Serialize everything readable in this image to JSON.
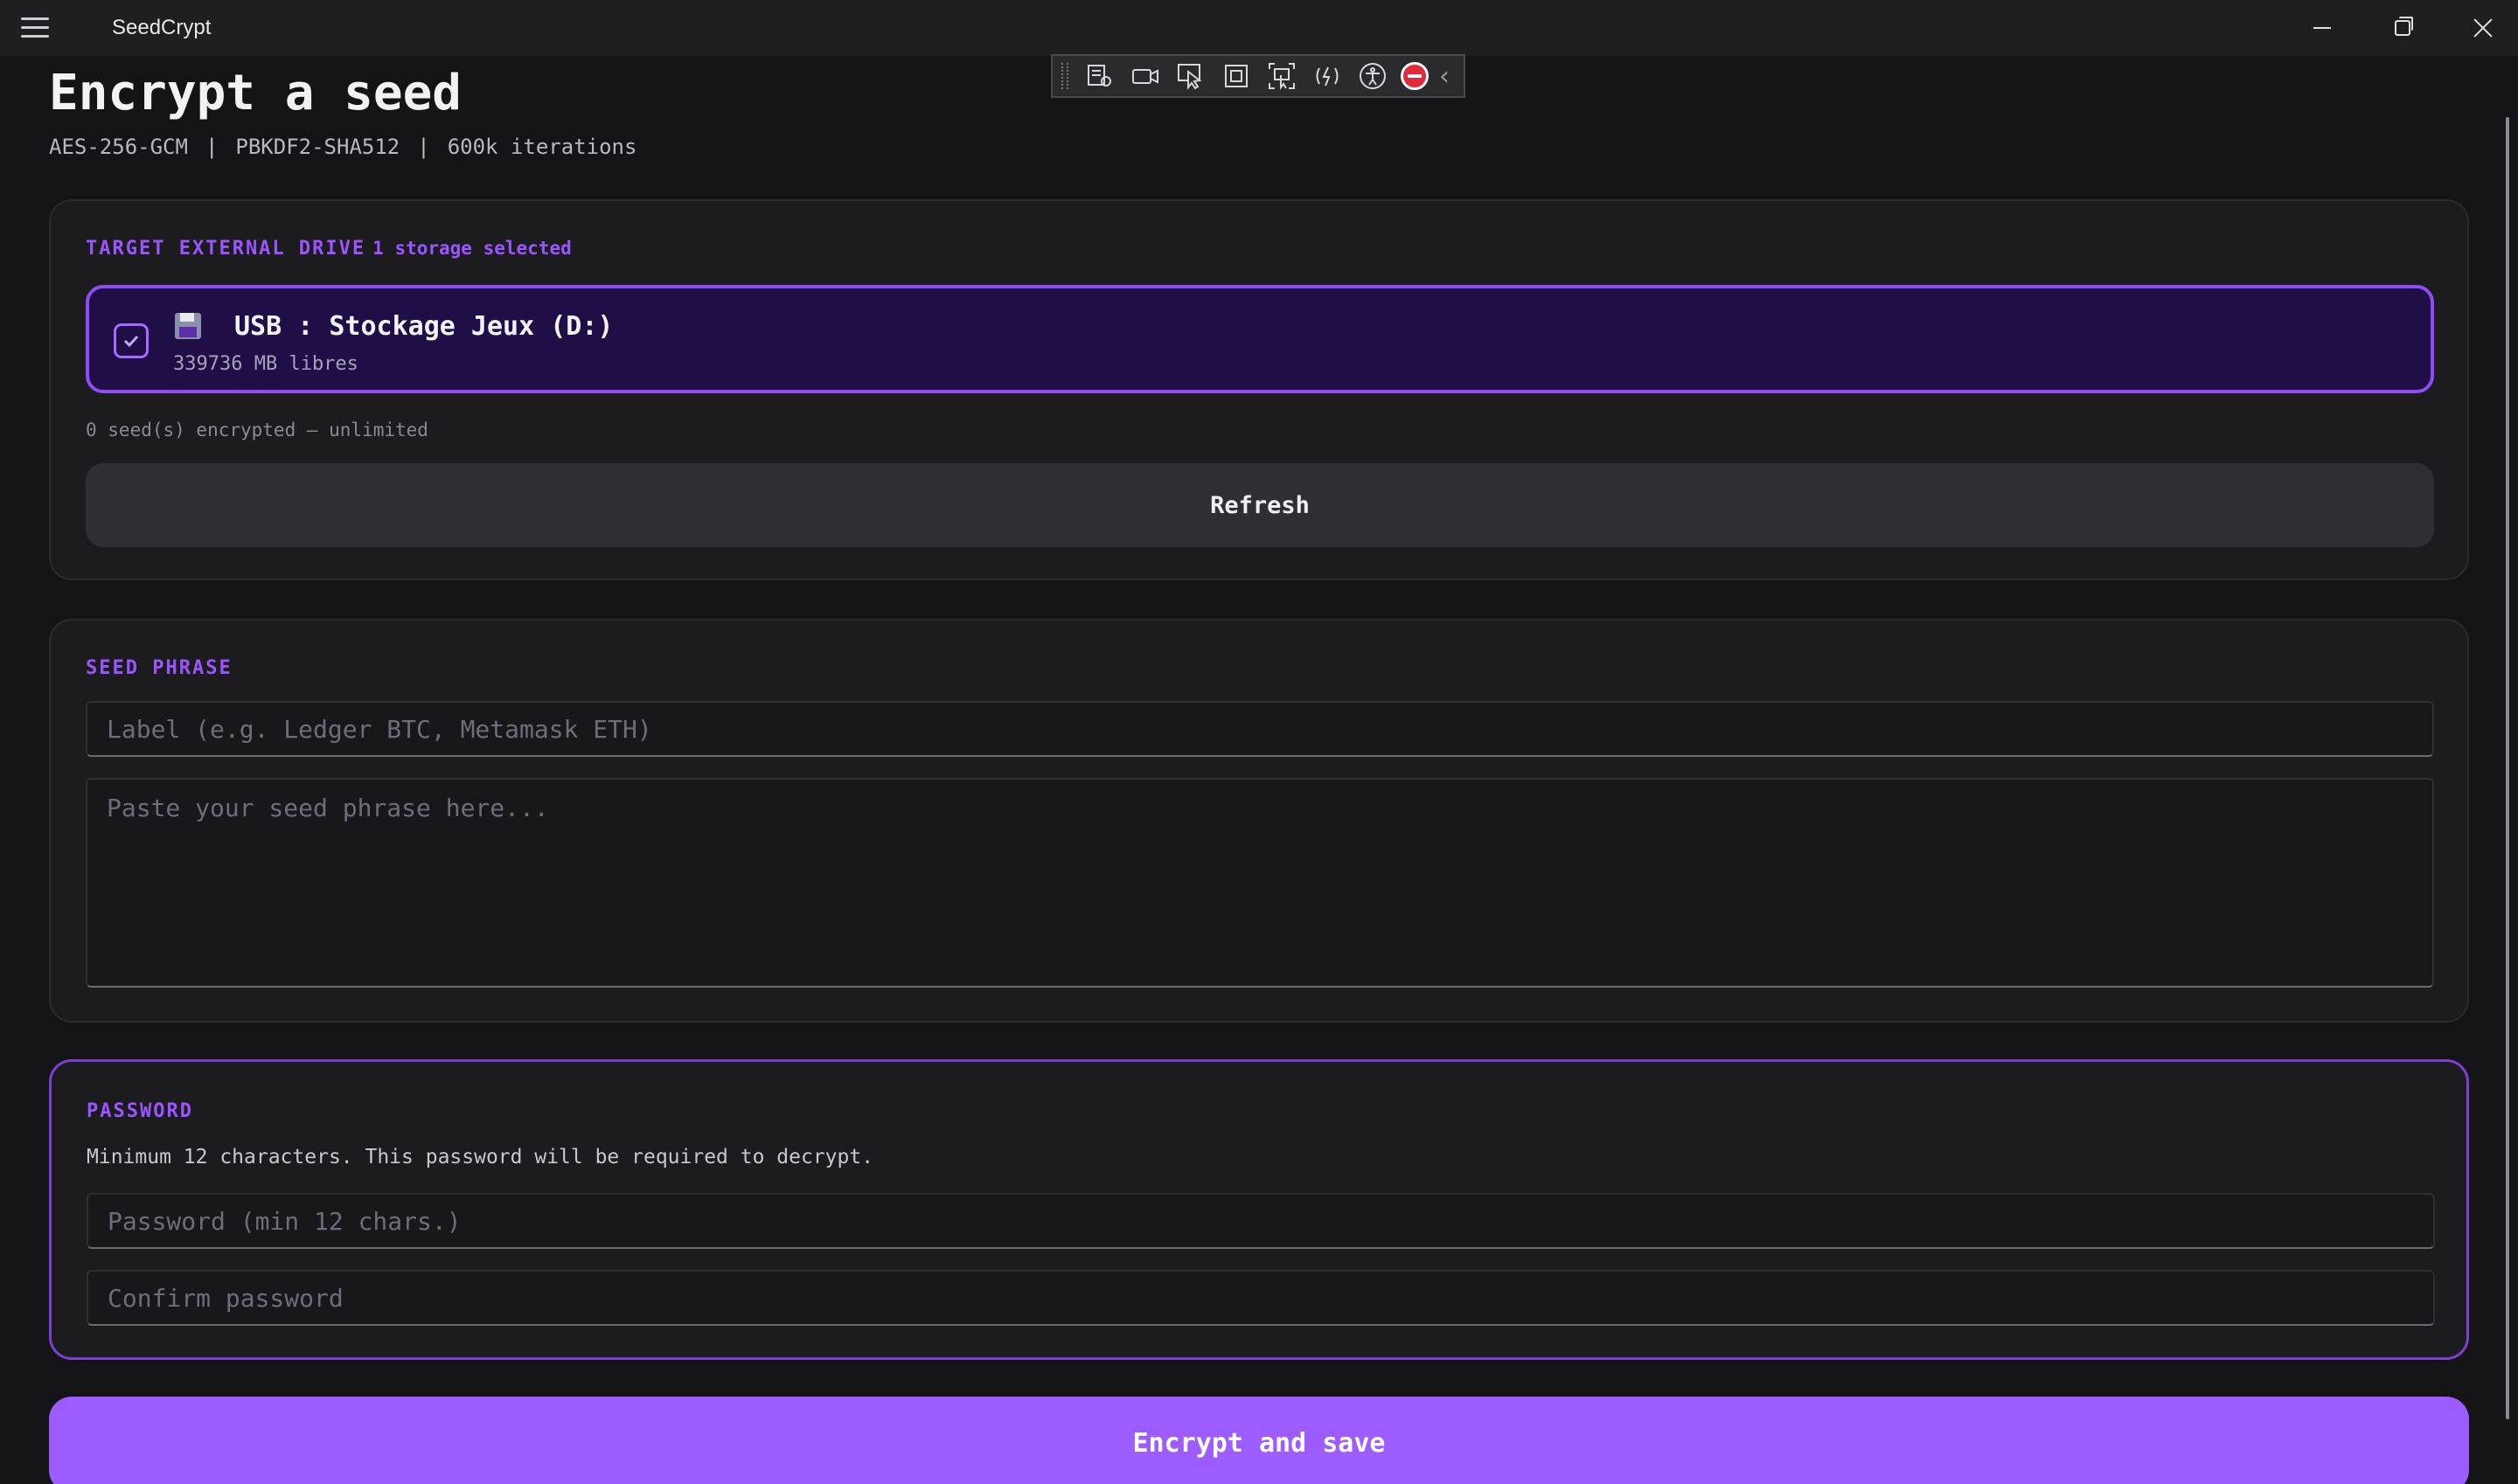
{
  "window": {
    "title": "SeedCrypt"
  },
  "header": {
    "title": "Encrypt a seed",
    "specs": [
      "AES-256-GCM",
      "PBKDF2-SHA512",
      "600k iterations"
    ],
    "separator": "|"
  },
  "target": {
    "label": "TARGET EXTERNAL DRIVE",
    "selected_text": "1 storage selected",
    "drives": [
      {
        "name": "USB : Stockage Jeux (D:)",
        "free": "339736 MB libres",
        "checked": true,
        "icon": "floppy-disk-icon"
      }
    ],
    "seed_count": "0 seed(s) encrypted — unlimited",
    "refresh_label": "Refresh"
  },
  "seed": {
    "label": "SEED PHRASE",
    "label_placeholder": "Label (e.g. Ledger BTC, Metamask ETH)",
    "phrase_placeholder": "Paste your seed phrase here..."
  },
  "password": {
    "label": "PASSWORD",
    "hint": "Minimum 12 characters. This password will be required to decrypt.",
    "password_placeholder": "Password (min 12 chars.)",
    "confirm_placeholder": "Confirm password"
  },
  "actions": {
    "encrypt_label": "Encrypt and save"
  },
  "colors": {
    "accent": "#9c5cff",
    "selected_bg": "#1f0f46",
    "background": "#141416"
  }
}
